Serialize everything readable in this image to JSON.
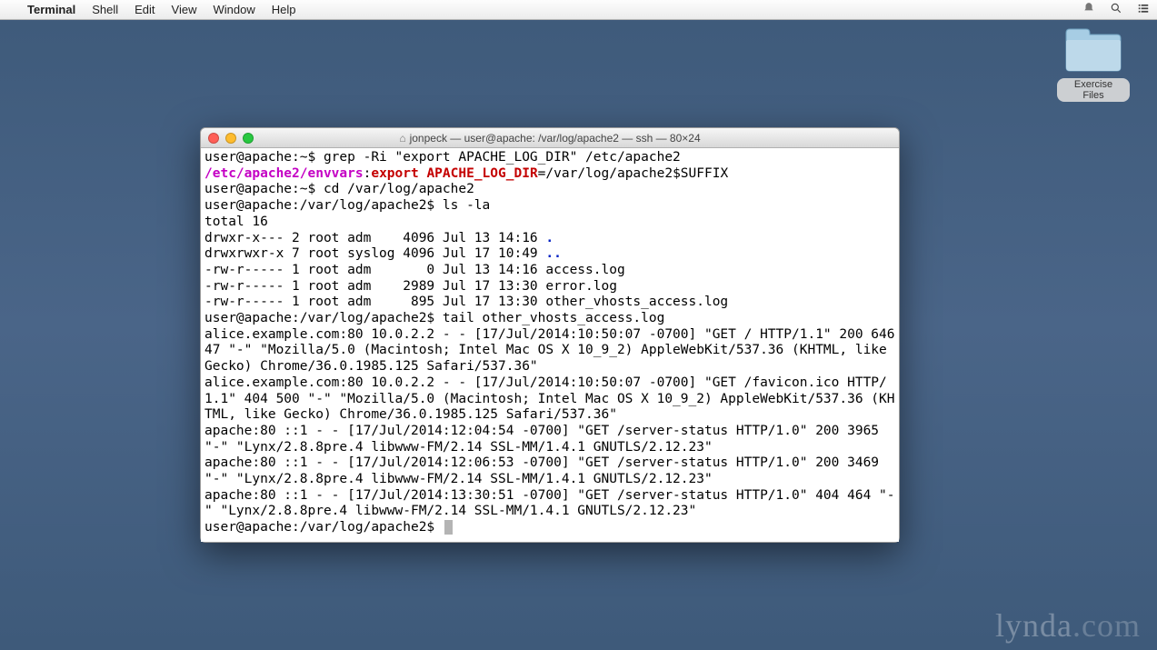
{
  "menubar": {
    "app_name": "Terminal",
    "items": [
      "Shell",
      "Edit",
      "View",
      "Window",
      "Help"
    ]
  },
  "desktop": {
    "folder_label": "Exercise Files"
  },
  "terminal": {
    "title": "jonpeck — user@apache: /var/log/apache2 — ssh — 80×24",
    "lines": [
      {
        "segments": [
          {
            "text": "user@apache:~$ grep -Ri \"export APACHE_LOG_DIR\" /etc/apache2"
          }
        ]
      },
      {
        "segments": [
          {
            "text": "/etc/apache2/envvars",
            "class": "magenta"
          },
          {
            "text": ":"
          },
          {
            "text": "export APACHE_LOG_DIR",
            "class": "redbold"
          },
          {
            "text": "=/var/log/apache2$SUFFIX"
          }
        ]
      },
      {
        "segments": [
          {
            "text": "user@apache:~$ cd /var/log/apache2"
          }
        ]
      },
      {
        "segments": [
          {
            "text": "user@apache:/var/log/apache2$ ls -la"
          }
        ]
      },
      {
        "segments": [
          {
            "text": "total 16"
          }
        ]
      },
      {
        "segments": [
          {
            "text": "drwxr-x--- 2 root adm    4096 Jul 13 14:16 "
          },
          {
            "text": ".",
            "class": "blue"
          }
        ]
      },
      {
        "segments": [
          {
            "text": "drwxrwxr-x 7 root syslog 4096 Jul 17 10:49 "
          },
          {
            "text": "..",
            "class": "blue"
          }
        ]
      },
      {
        "segments": [
          {
            "text": "-rw-r----- 1 root adm       0 Jul 13 14:16 access.log"
          }
        ]
      },
      {
        "segments": [
          {
            "text": "-rw-r----- 1 root adm    2989 Jul 17 13:30 error.log"
          }
        ]
      },
      {
        "segments": [
          {
            "text": "-rw-r----- 1 root adm     895 Jul 17 13:30 other_vhosts_access.log"
          }
        ]
      },
      {
        "segments": [
          {
            "text": "user@apache:/var/log/apache2$ tail other_vhosts_access.log"
          }
        ]
      },
      {
        "segments": [
          {
            "text": "alice.example.com:80 10.0.2.2 - - [17/Jul/2014:10:50:07 -0700] \"GET / HTTP/1.1\" 200 64647 \"-\" \"Mozilla/5.0 (Macintosh; Intel Mac OS X 10_9_2) AppleWebKit/537.36 (KHTML, like Gecko) Chrome/36.0.1985.125 Safari/537.36\""
          }
        ]
      },
      {
        "segments": [
          {
            "text": "alice.example.com:80 10.0.2.2 - - [17/Jul/2014:10:50:07 -0700] \"GET /favicon.ico HTTP/1.1\" 404 500 \"-\" \"Mozilla/5.0 (Macintosh; Intel Mac OS X 10_9_2) AppleWebKit/537.36 (KHTML, like Gecko) Chrome/36.0.1985.125 Safari/537.36\""
          }
        ]
      },
      {
        "segments": [
          {
            "text": "apache:80 ::1 - - [17/Jul/2014:12:04:54 -0700] \"GET /server-status HTTP/1.0\" 200 3965 \"-\" \"Lynx/2.8.8pre.4 libwww-FM/2.14 SSL-MM/1.4.1 GNUTLS/2.12.23\""
          }
        ]
      },
      {
        "segments": [
          {
            "text": "apache:80 ::1 - - [17/Jul/2014:12:06:53 -0700] \"GET /server-status HTTP/1.0\" 200 3469 \"-\" \"Lynx/2.8.8pre.4 libwww-FM/2.14 SSL-MM/1.4.1 GNUTLS/2.12.23\""
          }
        ]
      },
      {
        "segments": [
          {
            "text": "apache:80 ::1 - - [17/Jul/2014:13:30:51 -0700] \"GET /server-status HTTP/1.0\" 404 464 \"-\" \"Lynx/2.8.8pre.4 libwww-FM/2.14 SSL-MM/1.4.1 GNUTLS/2.12.23\""
          }
        ]
      },
      {
        "segments": [
          {
            "text": "user@apache:/var/log/apache2$ "
          }
        ],
        "cursor": true
      }
    ]
  },
  "watermark": {
    "brand": "lynda",
    "suffix": ".com"
  }
}
